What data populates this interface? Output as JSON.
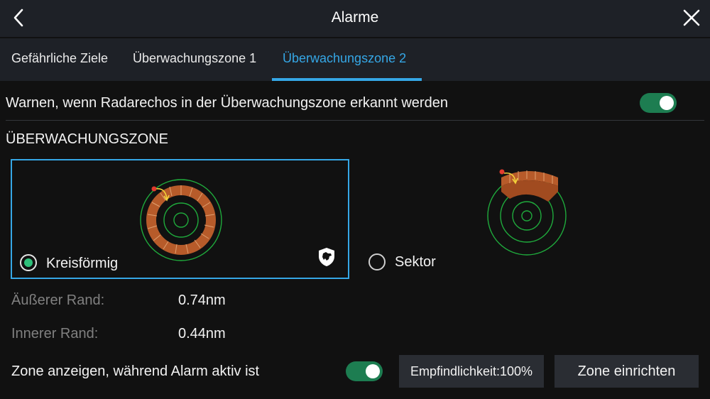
{
  "header": {
    "title": "Alarme",
    "back_icon": "chevron-left-icon",
    "close_icon": "close-icon"
  },
  "tabs": [
    {
      "label": "Gefährliche Ziele",
      "active": false
    },
    {
      "label": "Überwachungszone 1",
      "active": false
    },
    {
      "label": "Überwachungszone 2",
      "active": true
    }
  ],
  "alarm_toggle": {
    "label": "Warnen, wenn Radarechos in der Überwachungszone erkannt werden",
    "on": true
  },
  "zone_section": {
    "title": "ÜBERWACHUNGSZONE",
    "options": [
      {
        "label": "Kreisförmig",
        "selected": true,
        "badge_icon": "guard-dog-icon"
      },
      {
        "label": "Sektor",
        "selected": false
      }
    ]
  },
  "fields": [
    {
      "label": "Äußerer Rand:",
      "value": "0.74nm"
    },
    {
      "label": "Innerer Rand:",
      "value": "0.44nm"
    }
  ],
  "show_zone_toggle": {
    "label": "Zone anzeigen, während Alarm aktiv ist",
    "on": true
  },
  "buttons": {
    "sensitivity": "Empfindlichkeit:100%",
    "setup_zone": "Zone einrichten"
  },
  "colors": {
    "accent": "#35a7e6",
    "toggle_on": "#1d7d51",
    "ring": "#1faa3c",
    "zone_fill": "#b75b2a",
    "marker": "#e23b2e",
    "arrow": "#f2d23a"
  }
}
